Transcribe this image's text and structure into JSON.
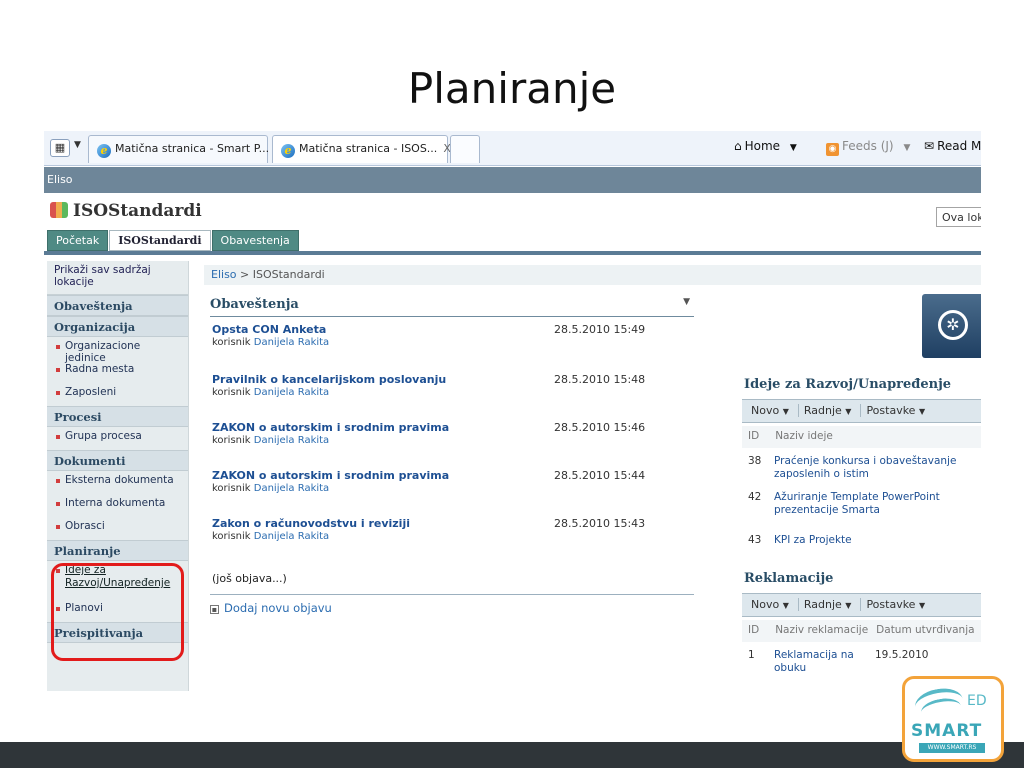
{
  "slide": {
    "title": "Planiranje"
  },
  "browser": {
    "tabs": [
      {
        "label": "Matična stranica - Smart P..."
      },
      {
        "label": "Matična stranica - ISOS...",
        "close": "X"
      }
    ],
    "commands": {
      "home": "Home",
      "feeds": "Feeds (J)",
      "read": "Read M"
    }
  },
  "site": {
    "top_label": "Eliso",
    "name": "ISOStandardi",
    "search_scope": "Ova loka",
    "top_nav": [
      "Početak",
      "ISOStandardi",
      "Obavestenja"
    ]
  },
  "left_nav": {
    "view_all": "Prikaži sav sadržaj lokacije",
    "sections": [
      {
        "head": "Obaveštenja"
      },
      {
        "head": "Organizacija",
        "items": [
          "Organizacione jedinice",
          "Radna mesta",
          "Zaposleni"
        ]
      },
      {
        "head": "Procesi",
        "items": [
          "Grupa procesa"
        ]
      },
      {
        "head": "Dokumenti",
        "items": [
          "Eksterna dokumenta",
          "Interna dokumenta",
          "Obrasci"
        ]
      },
      {
        "head": "Planiranje",
        "items": [
          "Ideje za Razvoj/Unapređenje",
          "Planovi"
        ]
      },
      {
        "head": "Preispitivanja"
      }
    ]
  },
  "breadcrumb": {
    "root": "Eliso",
    "sep": " > ",
    "current": "ISOStandardi"
  },
  "announcements": {
    "title": "Obaveštenja",
    "by_prefix": "korisnik",
    "items": [
      {
        "title": "Opsta CON Anketa",
        "author": "Danijela Rakita",
        "date": "28.5.2010 15:49"
      },
      {
        "title": "Pravilnik o kancelarijskom poslovanju",
        "author": "Danijela Rakita",
        "date": "28.5.2010 15:48"
      },
      {
        "title": "ZAKON o autorskim i srodnim pravima",
        "author": "Danijela Rakita",
        "date": "28.5.2010 15:46"
      },
      {
        "title": "ZAKON o autorskim i srodnim pravima",
        "author": "Danijela Rakita",
        "date": "28.5.2010 15:44"
      },
      {
        "title": "Zakon o računovodstvu i reviziji",
        "author": "Danijela Rakita",
        "date": "28.5.2010 15:43"
      }
    ],
    "more": "(još objava...)",
    "add_new": "Dodaj novu objavu"
  },
  "ideas": {
    "title": "Ideje za Razvoj/Unapređenje",
    "toolbar": [
      "Novo",
      "Radnje",
      "Postavke"
    ],
    "columns": [
      "ID",
      "Naziv ideje"
    ],
    "rows": [
      {
        "id": "38",
        "name": "Praćenje konkursa i obaveštavanje zaposlenih o istim"
      },
      {
        "id": "42",
        "name": "Ažuriranje Template PowerPoint prezentacije Smarta"
      },
      {
        "id": "43",
        "name": "KPI za Projekte"
      }
    ]
  },
  "complaints": {
    "title": "Reklamacije",
    "toolbar": [
      "Novo",
      "Radnje",
      "Postavke"
    ],
    "columns": [
      "ID",
      "Naziv reklamacije",
      "Datum utvrđivanja"
    ],
    "rows": [
      {
        "id": "1",
        "name": "Reklamacija na obuku",
        "date": "19.5.2010"
      }
    ]
  },
  "brand": {
    "ed": "ED",
    "word": "SMART",
    "url": "WWW.SMART.RS"
  },
  "colors": {
    "highlight": "#e21b1b",
    "nav": "#4f8a84",
    "brand": "#3aa6b7",
    "accent": "#f3a33a"
  }
}
